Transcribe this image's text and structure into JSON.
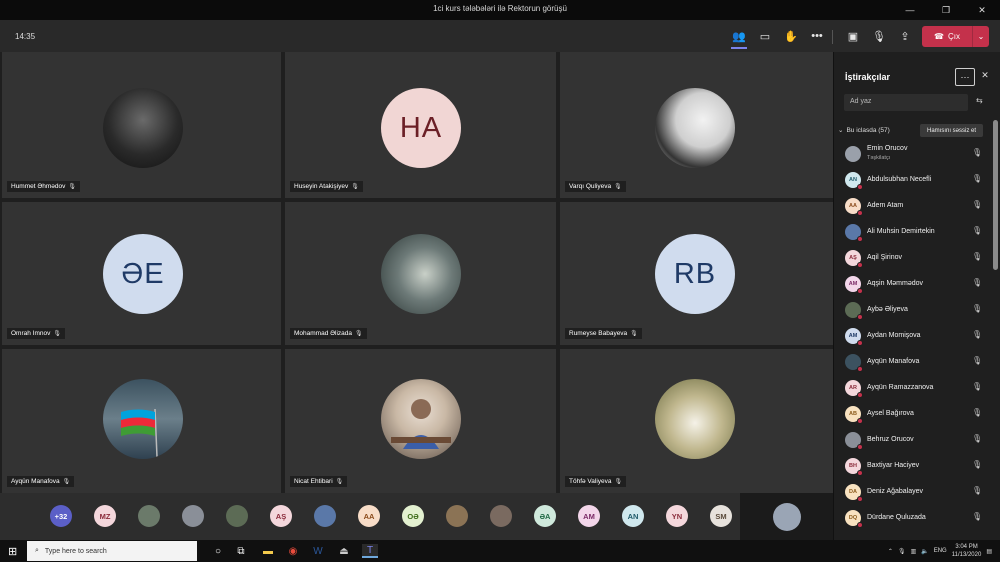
{
  "window": {
    "title": "1ci kurs tələbələri ilə Rektorun görüşü"
  },
  "toolbar": {
    "time": "14:35",
    "leave_label": "Çıx"
  },
  "tiles": [
    {
      "name": "Hummet Əhmədov",
      "initials": "",
      "photo": "dark"
    },
    {
      "name": "Huseyin Atakişiyev",
      "initials": "HA",
      "bg": "#f1d6d4",
      "fg": "#6b1f26"
    },
    {
      "name": "Varqı Quliyeva",
      "initials": "",
      "photo": "bw"
    },
    {
      "name": "Omrah Imnov",
      "initials": "ƏE",
      "bg": "#d0dcee",
      "fg": "#1f3a66"
    },
    {
      "name": "Mohammad Əlizada",
      "initials": "",
      "photo": "art"
    },
    {
      "name": "Rumeyse Babayeva",
      "initials": "RB",
      "bg": "#d0dcee",
      "fg": "#1f3a66"
    },
    {
      "name": "Ayqün Manafova",
      "initials": "",
      "photo": "flag"
    },
    {
      "name": "Nicat Ehtibari",
      "initials": "",
      "photo": "man"
    },
    {
      "name": "Töhfə Valiyeva",
      "initials": "",
      "photo": "dand"
    }
  ],
  "strip": {
    "items": [
      {
        "label": "+32",
        "bg": "#5b5fc7",
        "fg": "#ffffff"
      },
      {
        "label": "MZ",
        "bg": "#f4d7dc",
        "fg": "#8a2a3a"
      },
      {
        "label": "",
        "bg": "#6b7a6a",
        "fg": "#fff"
      },
      {
        "label": "",
        "bg": "#8a8f98",
        "fg": "#fff"
      },
      {
        "label": "",
        "bg": "#5c6b55",
        "fg": "#fff"
      },
      {
        "label": "AŞ",
        "bg": "#f4d7dc",
        "fg": "#8a2a3a"
      },
      {
        "label": "",
        "bg": "#5a78a8",
        "fg": "#fff"
      },
      {
        "label": "AA",
        "bg": "#f8ddc8",
        "fg": "#8a4a1a"
      },
      {
        "label": "OƏ",
        "bg": "#e3f0d0",
        "fg": "#3e6b1a"
      },
      {
        "label": "",
        "bg": "#8b7355",
        "fg": "#fff"
      },
      {
        "label": "",
        "bg": "#7a6a60",
        "fg": "#fff"
      },
      {
        "label": "ƏA",
        "bg": "#cfe9dc",
        "fg": "#1f6a45"
      },
      {
        "label": "AM",
        "bg": "#f3d6ea",
        "fg": "#7a2a66"
      },
      {
        "label": "AN",
        "bg": "#d0e8ee",
        "fg": "#1f5a6a"
      },
      {
        "label": "YN",
        "bg": "#f4d7dc",
        "fg": "#8a2a3a"
      },
      {
        "label": "SM",
        "bg": "#e7e2dc",
        "fg": "#5a4a3a"
      }
    ],
    "self": {
      "label": "",
      "bg": "#9aa5b5"
    }
  },
  "panel": {
    "title": "İştirakçılar",
    "more": "···",
    "close": "✕",
    "search_placeholder": "Ad yaz",
    "section_label": "Bu iclasda (57)",
    "mute_all": "Hamısını səssiz et",
    "participants": [
      {
        "name": "Emin Orucov",
        "role": "Təşkilatçı",
        "initials": "",
        "bg": "#9aa0aa",
        "fg": "#fff",
        "dot": false
      },
      {
        "name": "Abdulsubhan Necefli",
        "role": "",
        "initials": "AN",
        "bg": "#d0e8ee",
        "fg": "#1f5a6a",
        "dot": true
      },
      {
        "name": "Adem Atam",
        "role": "",
        "initials": "AA",
        "bg": "#f8ddc8",
        "fg": "#8a4a1a",
        "dot": true
      },
      {
        "name": "Ali Muhsin Demirtekin",
        "role": "",
        "initials": "",
        "bg": "#5a78a8",
        "fg": "#fff",
        "dot": true
      },
      {
        "name": "Aqil Şirinov",
        "role": "",
        "initials": "AŞ",
        "bg": "#f4d7dc",
        "fg": "#8a2a3a",
        "dot": true
      },
      {
        "name": "Aqşin Məmmədov",
        "role": "",
        "initials": "AM",
        "bg": "#f3d6ea",
        "fg": "#7a2a66",
        "dot": true
      },
      {
        "name": "Aybə Əliyeva",
        "role": "",
        "initials": "",
        "bg": "#5c6b55",
        "fg": "#fff",
        "dot": true
      },
      {
        "name": "Aydan Momişova",
        "role": "",
        "initials": "AM",
        "bg": "#d0dcee",
        "fg": "#1f3a66",
        "dot": true
      },
      {
        "name": "Ayqün Manafova",
        "role": "",
        "initials": "",
        "bg": "#3c5260",
        "fg": "#fff",
        "dot": true
      },
      {
        "name": "Ayqün Ramazzanova",
        "role": "",
        "initials": "AR",
        "bg": "#f4d7dc",
        "fg": "#8a2a3a",
        "dot": true
      },
      {
        "name": "Aysel Bağırova",
        "role": "",
        "initials": "AB",
        "bg": "#f8e2c0",
        "fg": "#8a5a1a",
        "dot": true
      },
      {
        "name": "Behruz Orucov",
        "role": "",
        "initials": "",
        "bg": "#8a8f98",
        "fg": "#fff",
        "dot": true
      },
      {
        "name": "Baxtiyar Haciyev",
        "role": "",
        "initials": "BH",
        "bg": "#f4d7dc",
        "fg": "#8a2a3a",
        "dot": true
      },
      {
        "name": "Deniz Ağabalayev",
        "role": "",
        "initials": "DA",
        "bg": "#f8e2c0",
        "fg": "#8a5a1a",
        "dot": true
      },
      {
        "name": "Dürdane Quluzada",
        "role": "",
        "initials": "DQ",
        "bg": "#f8e2c0",
        "fg": "#8a5a1a",
        "dot": true
      }
    ]
  },
  "taskbar": {
    "search_placeholder": "Type here to search",
    "lang": "ENG",
    "time": "3:04 PM",
    "date": "11/13/2020"
  }
}
